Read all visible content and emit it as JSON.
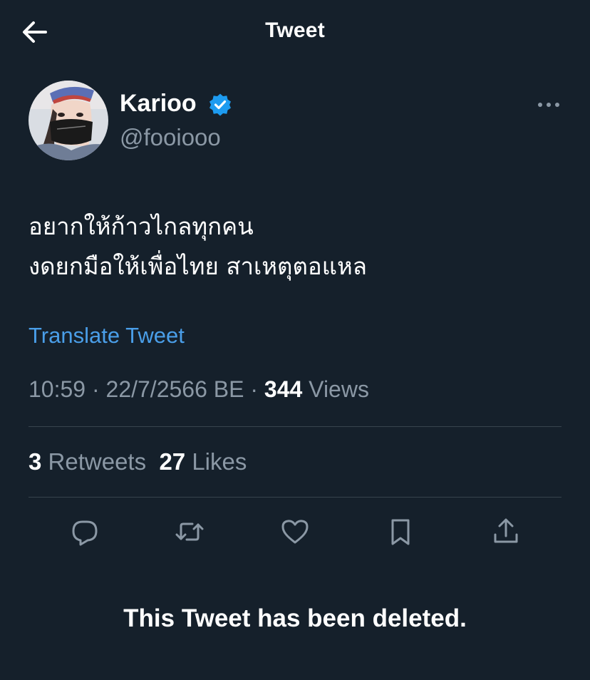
{
  "header": {
    "title": "Tweet",
    "back_icon": "arrow-left-icon"
  },
  "author": {
    "display_name": "Karioo",
    "handle": "@fooiooo",
    "verified": true,
    "verified_icon": "verified-badge-icon"
  },
  "menu_icon": "more-horizontal-icon",
  "tweet": {
    "lines": [
      "อยากให้ก้าวไกลทุกคน",
      "งดยกมือให้เพื่อไทย สาเหตุตอแหล"
    ],
    "translate_label": "Translate Tweet",
    "time": "10:59",
    "date": "22/7/2566 BE",
    "views_count": "344",
    "views_label": "Views"
  },
  "stats": {
    "retweets_count": "3",
    "retweets_label": "Retweets",
    "likes_count": "27",
    "likes_label": "Likes"
  },
  "actions": [
    {
      "icon": "reply-icon"
    },
    {
      "icon": "retweet-icon"
    },
    {
      "icon": "like-heart-icon"
    },
    {
      "icon": "bookmark-icon"
    },
    {
      "icon": "share-icon"
    }
  ],
  "footer": {
    "deleted_notice": "This Tweet has been deleted."
  },
  "colors": {
    "background": "#15202b",
    "secondary_text": "#8b98a5",
    "link": "#4a9ee8",
    "verified": "#1d9bf0",
    "divider": "#38444d"
  }
}
